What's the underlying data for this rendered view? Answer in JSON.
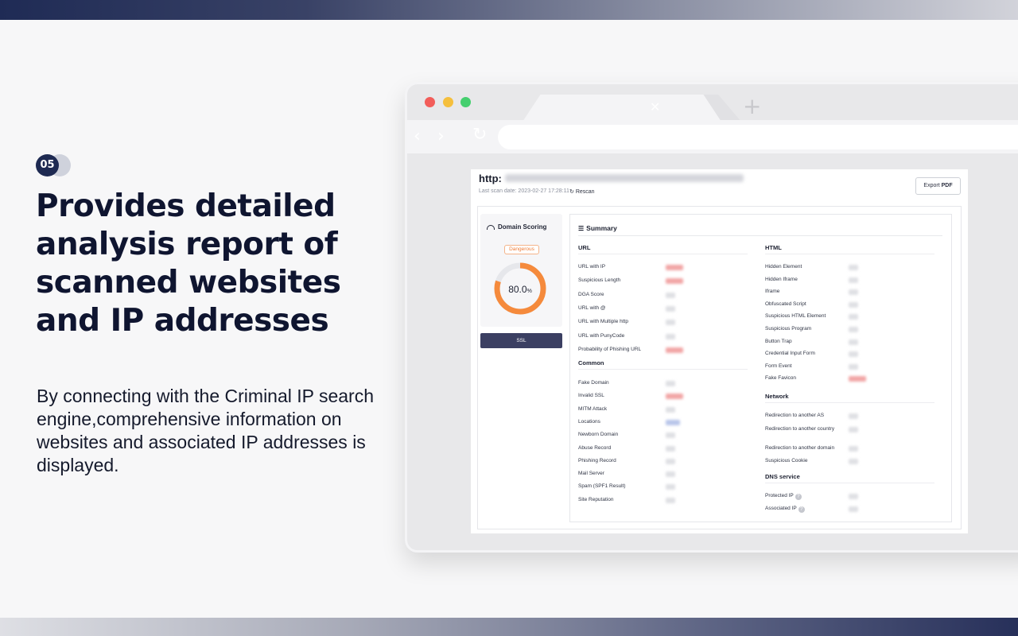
{
  "slide": {
    "step_number": "05",
    "headline": "Provides detailed analysis report of scanned websites and IP addresses",
    "description": "By connecting with the Criminal IP search engine,comprehensive information on websites and associated IP addresses is displayed."
  },
  "browser": {
    "tab_close_icon": "close-icon",
    "new_tab_icon": "plus-icon",
    "back_icon": "back-icon",
    "forward_icon": "forward-icon",
    "reload_icon": "reload-icon"
  },
  "report": {
    "url_prefix": "http:",
    "last_scan": "Last scan date: 2023-02-27 17:28:11",
    "rescan_label": "Rescan",
    "export_label": "Export",
    "export_format": "PDF",
    "domain_scoring": {
      "title": "Domain Scoring",
      "status": "Dangerous",
      "score": "80.0",
      "score_unit": "%",
      "score_value": 80.0,
      "ring_color": "#f58a3c"
    },
    "ssl_label": "SSL",
    "summary_title": "Summary",
    "sections": {
      "url": {
        "title": "URL",
        "rows": [
          "URL with IP",
          "Suspicious Length",
          "DGA Score",
          "URL with @",
          "URL with Multiple http",
          "URL with PunyCode",
          "Probability of Phishing URL"
        ]
      },
      "common": {
        "title": "Common",
        "rows": [
          "Fake Domain",
          "Invalid SSL",
          "MITM Attack",
          "Locations",
          "Newborn Domain",
          "Abuse Record",
          "Phishing Record",
          "Mail Server",
          "Spam (SPF1 Result)",
          "Site Reputation"
        ]
      },
      "html": {
        "title": "HTML",
        "rows": [
          "Hidden Element",
          "Hidden Iframe",
          "Iframe",
          "Obfuscated Script",
          "Suspicious HTML Element",
          "Suspicious Program",
          "Button Trap",
          "Credential Input Form",
          "Form Event",
          "Fake Favicon"
        ]
      },
      "network": {
        "title": "Network",
        "rows": [
          "Redirection to another AS",
          "Redirection to another country",
          "Redirection to another domain",
          "Suspicious Cookie"
        ]
      },
      "dns": {
        "title": "DNS service",
        "rows": [
          "Protected IP",
          "Associated IP"
        ]
      }
    }
  }
}
